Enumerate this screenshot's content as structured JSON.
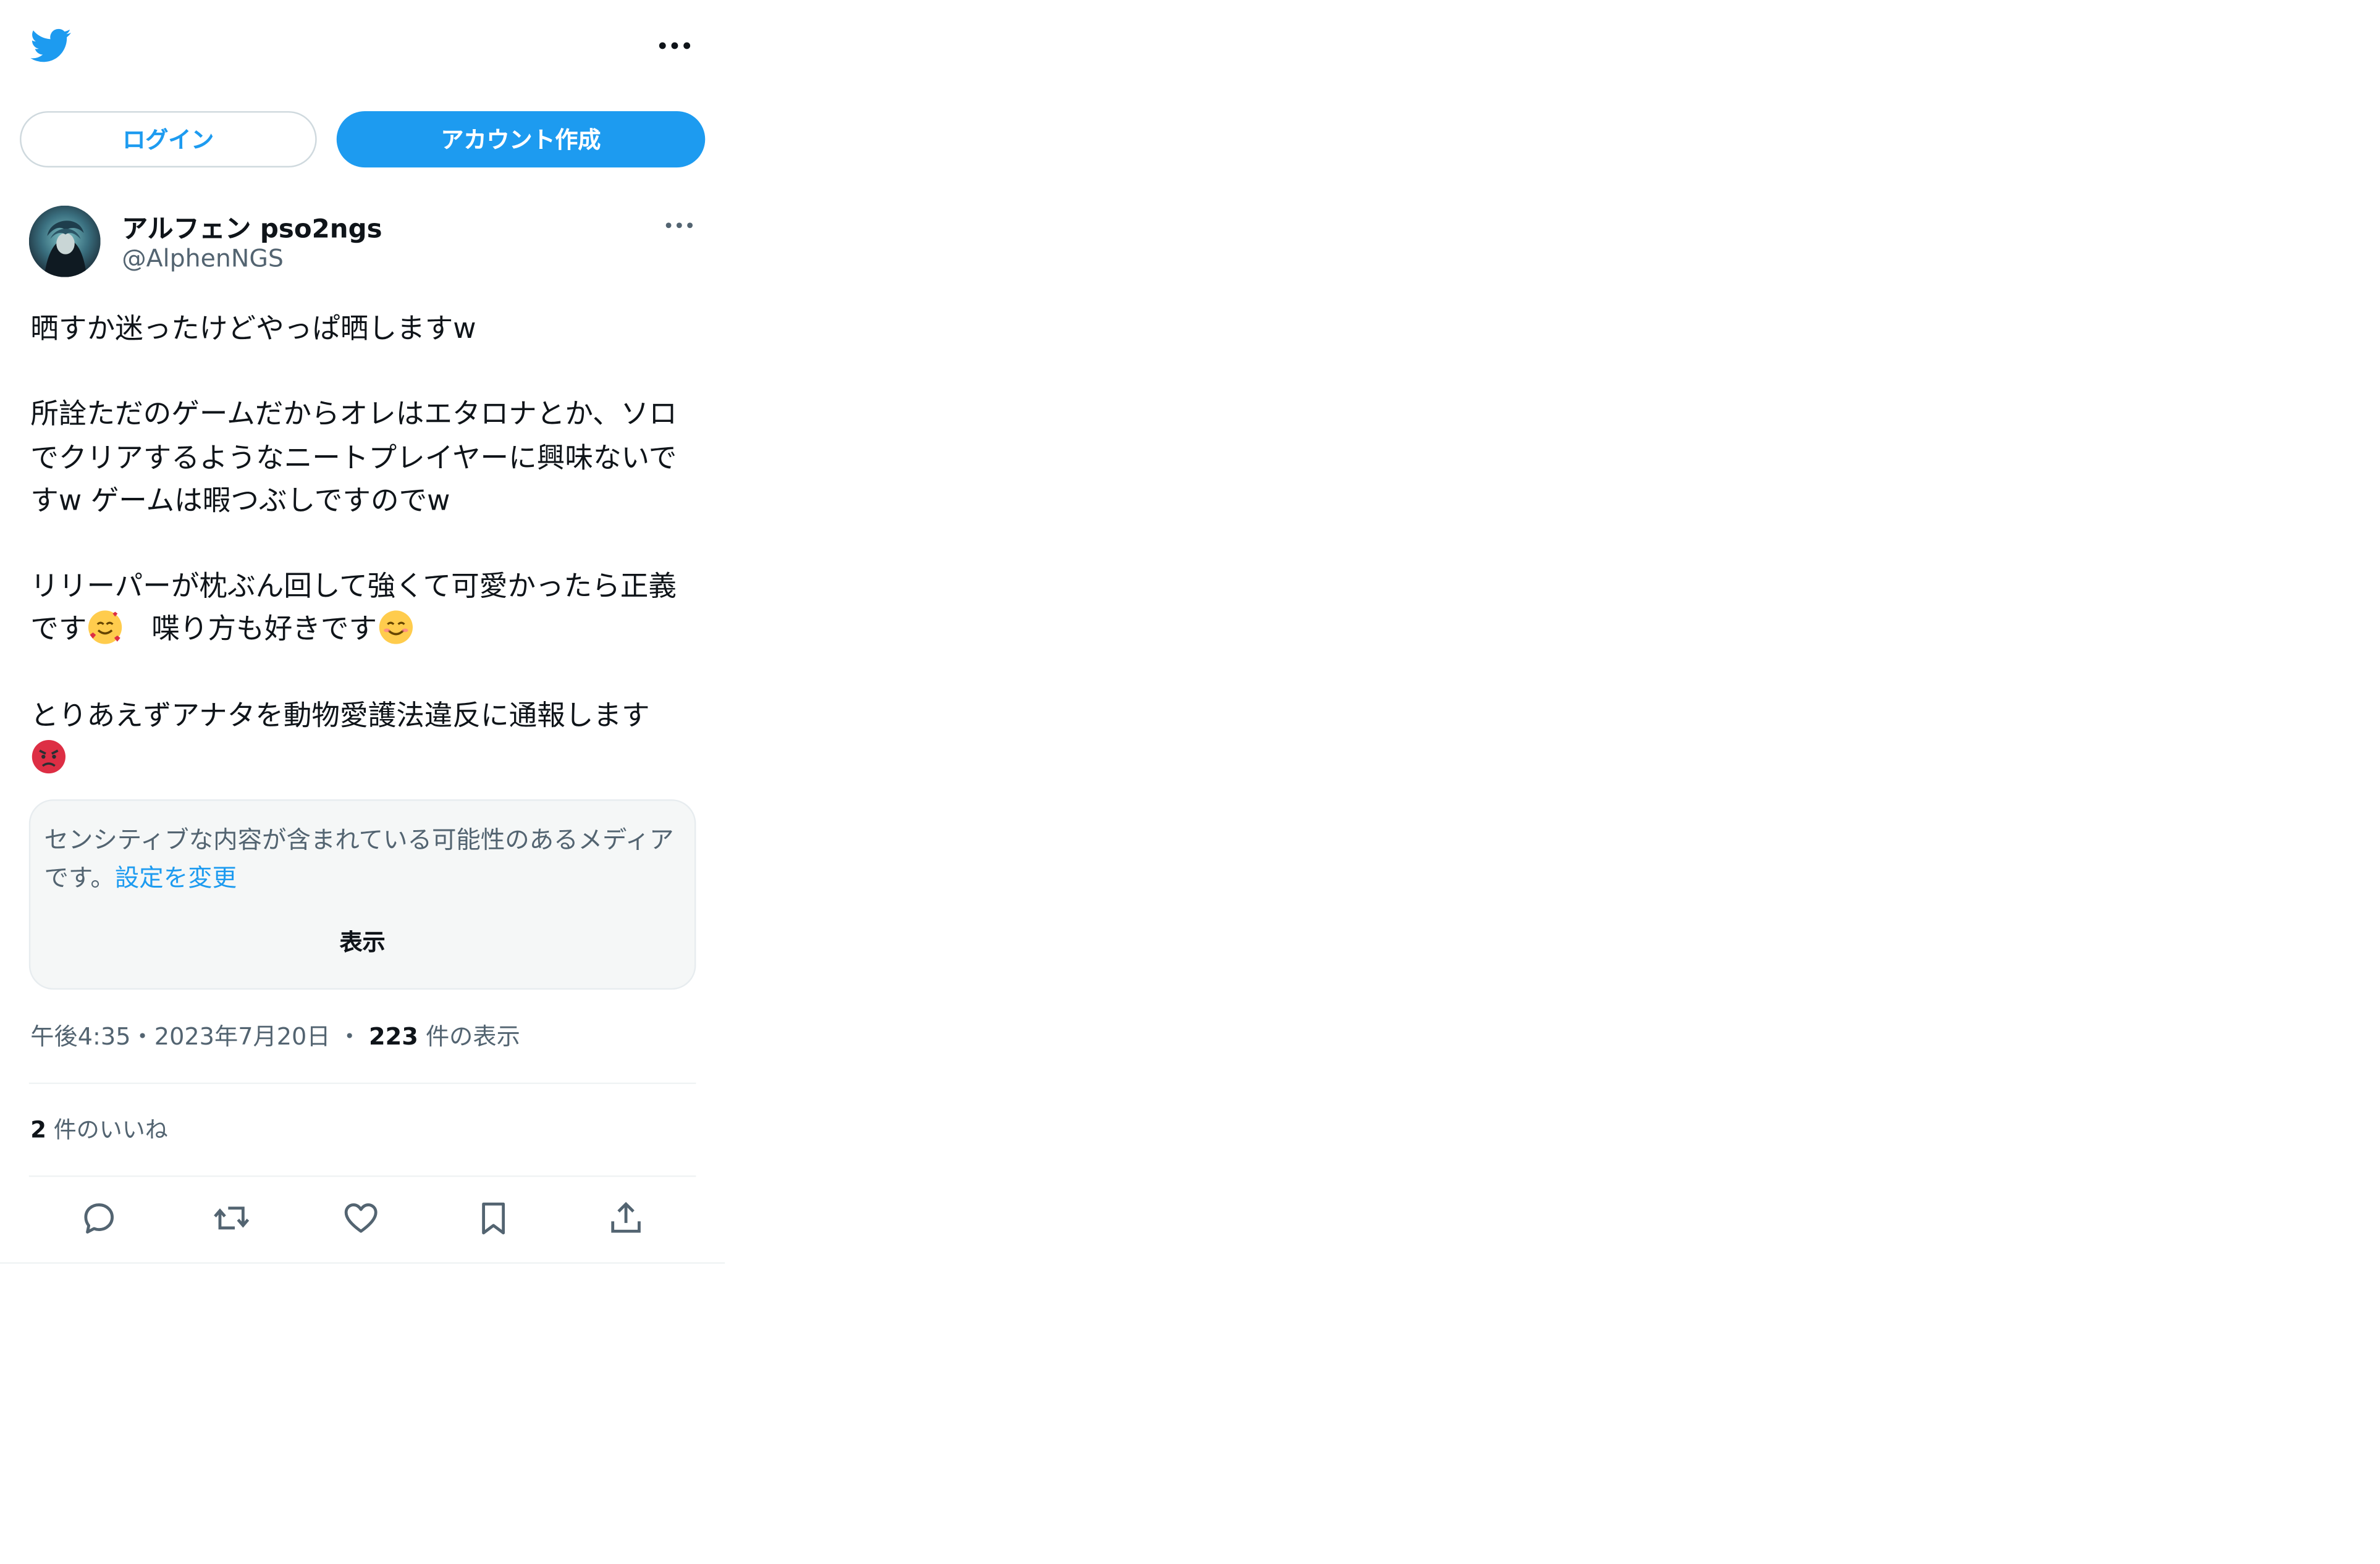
{
  "header": {
    "logo_icon": "twitter-bird-icon",
    "more_icon": "more-dots-icon",
    "brand_color": "#1d9bf0"
  },
  "auth": {
    "login_label": "ログイン",
    "signup_label": "アカウント作成"
  },
  "tweet": {
    "author": {
      "display_name": "アルフェン pso2ngs",
      "handle": "@AlphenNGS"
    },
    "text": {
      "line1": "晒すか迷ったけどやっぱ晒しますw",
      "para2": "所詮ただのゲームだからオレはエタロナとか、ソロでクリアするようなニートプレイヤーに興味ないですw ゲームは暇つぶしですのでw",
      "para3a": "リリーパーが枕ぶん回して強くて可愛かったら正義です",
      "para3b": "　喋り方も好きです",
      "para4": "とりあえずアナタを動物愛護法違反に通報します"
    },
    "emojis": [
      "smiling-face-with-hearts-icon",
      "smiling-face-icon",
      "angry-face-icon"
    ],
    "sensitive": {
      "message": "センシティブな内容が含まれている可能性のあるメディアです。",
      "change_settings": "設定を変更",
      "show_label": "表示"
    },
    "meta": {
      "time": "午後4:35",
      "separator": "・",
      "date": "2023年7月20日",
      "views_count": "223",
      "views_label": "件の表示"
    },
    "likes": {
      "count": "2",
      "label": "件のいいね"
    },
    "actions": [
      "reply-icon",
      "retweet-icon",
      "like-icon",
      "bookmark-icon",
      "share-icon"
    ]
  }
}
